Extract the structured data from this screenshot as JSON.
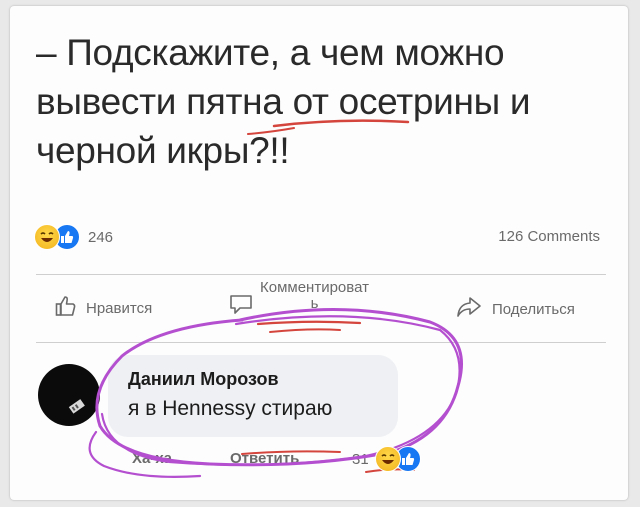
{
  "post": {
    "text_line1": "– Подскажите, а чем можно",
    "text_line2": "вывести пятна от осетрины и",
    "text_line3": "черной икры?!!"
  },
  "stats": {
    "reaction_count": "246",
    "comments_count": "126 Comments"
  },
  "actions": {
    "like_label": "Нравится",
    "comment_label_line1": "Комментироват",
    "comment_label_line2": "ь",
    "share_label": "Поделиться"
  },
  "comment": {
    "author": "Даниил Морозов",
    "text": "я в Hennessy стираю",
    "haha_label": "Ха-ха",
    "reply_label": "Ответить",
    "reaction_count": "31"
  },
  "icons": {
    "reaction1": "laughing-emoji-icon",
    "reaction2": "like-thumb-icon",
    "like": "thumbs-up-outline-icon",
    "comment": "speech-bubble-icon",
    "share": "share-arrow-icon"
  },
  "colors": {
    "like_blue": "#1877f2",
    "marker_purple": "#b44fd0",
    "underline_red": "#d4453d"
  }
}
